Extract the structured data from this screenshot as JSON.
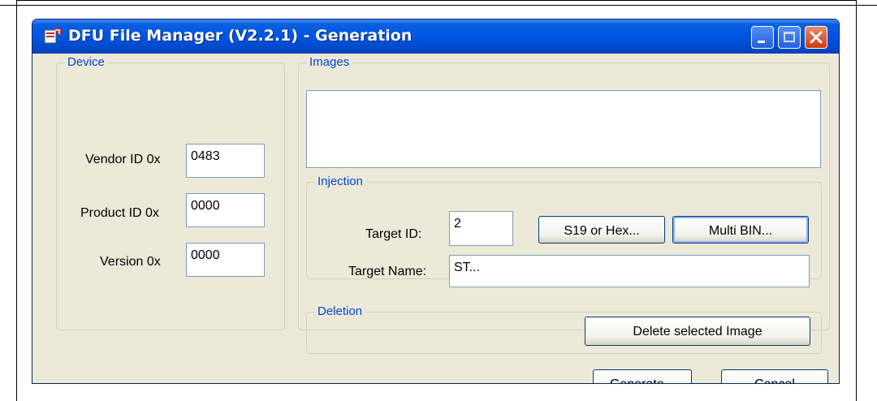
{
  "window": {
    "title": "DFU File Manager (V2.2.1) - Generation",
    "controls": {
      "minimize_icon": "minimize-icon",
      "maximize_icon": "maximize-icon",
      "close_icon": "close-icon"
    }
  },
  "device": {
    "group_label": "Device",
    "vendor_label": "Vendor ID 0x",
    "vendor_value": "0483",
    "product_label": "Product ID 0x",
    "product_value": "0000",
    "version_label": "Version 0x",
    "version_value": "0000"
  },
  "images": {
    "group_label": "Images",
    "items": []
  },
  "injection": {
    "group_label": "Injection",
    "target_id_label": "Target ID:",
    "target_id_value": "2",
    "s19_hex_button": "S19 or Hex...",
    "multi_bin_button": "Multi BIN...",
    "target_name_label": "Target Name:",
    "target_name_value": "ST..."
  },
  "deletion": {
    "group_label": "Deletion",
    "delete_button": "Delete selected Image"
  },
  "footer": {
    "generate_button": "Generate...",
    "cancel_button": "Cancel"
  },
  "colors": {
    "titlebar": "#0054e3",
    "group_label": "#0046d5",
    "window_bg": "#ece9d8",
    "close_button": "#cf3a10"
  }
}
